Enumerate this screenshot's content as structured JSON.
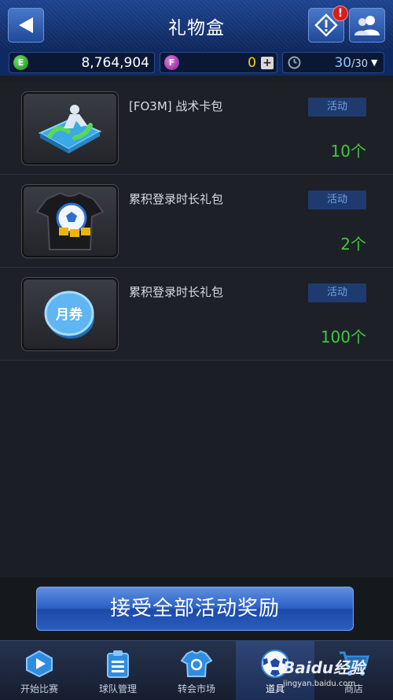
{
  "header": {
    "title": "礼物盒",
    "alert_badge": "!"
  },
  "currency": {
    "e_icon_letter": "E",
    "e_value": "8,764,904",
    "f_icon_letter": "F",
    "f_value": "0",
    "plus_label": "+",
    "stamina_current": "30",
    "stamina_max": "/30",
    "dropdown_arrow": "▼"
  },
  "items": [
    {
      "name": "[FO3M] 战术卡包",
      "tag": "活动",
      "count": "10个",
      "icon": "tactic-card-icon"
    },
    {
      "name": "累积登录时长礼包",
      "tag": "活动",
      "count": "2个",
      "icon": "jersey-ball-icon"
    },
    {
      "name": "累积登录时长礼包",
      "tag": "活动",
      "count": "100个",
      "icon": "monthly-coupon-icon",
      "coupon_text": "月券"
    }
  ],
  "accept_button": {
    "label": "接受全部活动奖励"
  },
  "nav": [
    {
      "label": "开始比赛",
      "icon": "play-icon"
    },
    {
      "label": "球队管理",
      "icon": "clipboard-icon"
    },
    {
      "label": "转会市场",
      "icon": "shirt-icon"
    },
    {
      "label": "道具",
      "icon": "soccer-ball-icon",
      "active": true
    },
    {
      "label": "商店",
      "icon": "cart-icon"
    }
  ],
  "watermark": {
    "brand": "Baidu经验",
    "url": "jingyan.baidu.com"
  },
  "colors": {
    "header_blue": "#1c4290",
    "count_green": "#3fc93f",
    "tag_text": "#6fa3e6",
    "stamina_blue": "#8fc4ff",
    "f_value_yellow": "#ffd400"
  }
}
